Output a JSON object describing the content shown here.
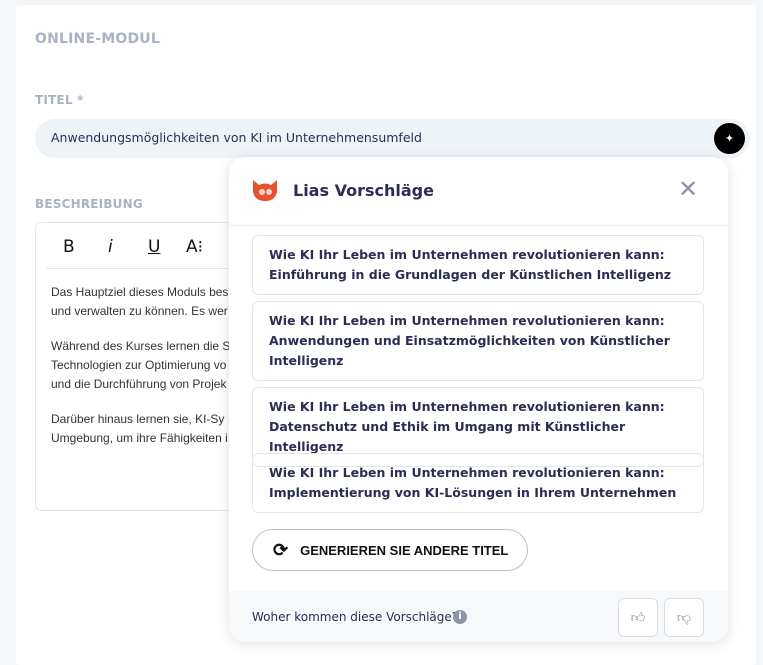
{
  "section_title": "ONLINE-MODUL",
  "title_field": {
    "label": "TITEL *",
    "value": "Anwendungsmöglichkeiten von KI im Unternehmensumfeld"
  },
  "description": {
    "label": "BESCHREIBUNG",
    "toolbar": {
      "bold": "B",
      "italic": "i",
      "underline": "U",
      "font_size": "A⁝"
    },
    "paragraphs": [
      [
        "Das Hauptziel dieses Moduls bes",
        "und verwalten zu können. Es wer"
      ],
      [
        " Während des Kurses lernen die S",
        "Technologien zur Optimierung vo",
        "und die Durchführung von Projek"
      ],
      [
        " Darüber hinaus lernen sie, KI-Sy",
        "Umgebung, um ihre Fähigkeiten i"
      ]
    ]
  },
  "popup": {
    "title": "Lias Vorschläge",
    "suggestions": [
      [
        "Wie KI Ihr Leben im Unternehmen revolutionieren kann:",
        "Einführung in die Grundlagen der Künstlichen Intelligenz"
      ],
      [
        "Wie KI Ihr Leben im Unternehmen revolutionieren kann:",
        "Anwendungen und Einsatzmöglichkeiten von Künstlicher",
        "Intelligenz"
      ],
      [
        "Wie KI Ihr Leben im Unternehmen revolutionieren kann:",
        "Datenschutz und Ethik im Umgang mit Künstlicher Intelligenz"
      ],
      [
        "Wie KI Ihr Leben im Unternehmen revolutionieren kann:",
        "Implementierung von KI-Lösungen in Ihrem Unternehmen"
      ]
    ],
    "generate_label": "GENERIEREN SIE ANDERE TITEL",
    "footer_text": "Woher kommen diese Vorschläge?"
  }
}
